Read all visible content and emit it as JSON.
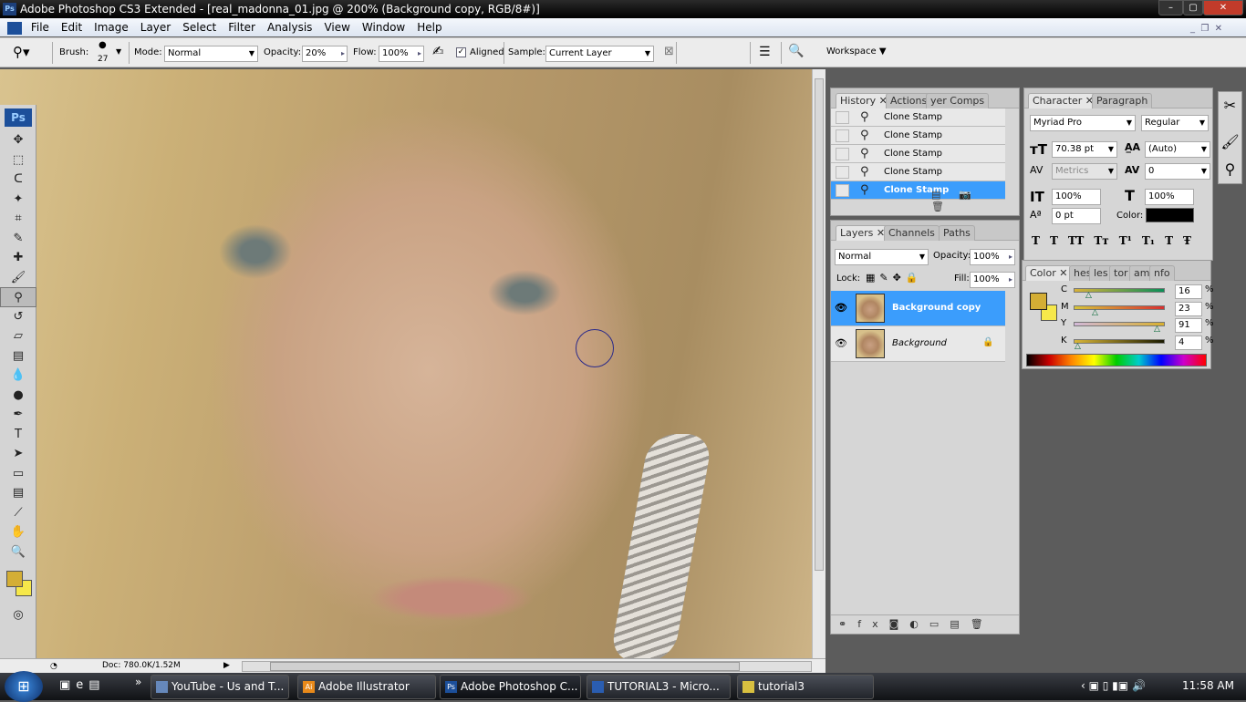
{
  "window": {
    "title": "Adobe Photoshop CS3 Extended - [real_madonna_01.jpg @ 200% (Background copy, RGB/8#)]",
    "app_icon": "Ps"
  },
  "menu": [
    "File",
    "Edit",
    "Image",
    "Layer",
    "Select",
    "Filter",
    "Analysis",
    "View",
    "Window",
    "Help"
  ],
  "options": {
    "brush_label": "Brush:",
    "brush_size": "27",
    "mode_label": "Mode:",
    "mode": "Normal",
    "opacity_label": "Opacity:",
    "opacity": "20%",
    "flow_label": "Flow:",
    "flow": "100%",
    "aligned_label": "Aligned",
    "aligned": true,
    "sample_label": "Sample:",
    "sample": "Current Layer",
    "workspace": "Workspace ▼"
  },
  "history": {
    "tabs": [
      "History",
      "Actions",
      "yer Comps"
    ],
    "items": [
      "Clone Stamp",
      "Clone Stamp",
      "Clone Stamp",
      "Clone Stamp",
      "Clone Stamp"
    ]
  },
  "layers": {
    "tabs": [
      "Layers",
      "Channels",
      "Paths"
    ],
    "blend": "Normal",
    "opacity_label": "Opacity:",
    "opacity": "100%",
    "lock_label": "Lock:",
    "fill_label": "Fill:",
    "fill": "100%",
    "items": [
      {
        "name": "Background copy",
        "selected": true
      },
      {
        "name": "Background",
        "locked": true
      }
    ]
  },
  "character": {
    "tabs": [
      "Character",
      "Paragraph"
    ],
    "font": "Myriad Pro",
    "style": "Regular",
    "size": "70.38 pt",
    "leading": "(Auto)",
    "kerning": "Metrics",
    "tracking": "0",
    "vscale": "100%",
    "hscale": "100%",
    "baseline": "0 pt",
    "color_label": "Color:",
    "text_color": "#000000",
    "style_buttons": [
      "T",
      "T",
      "TT",
      "Tт",
      "T¹",
      "T₁",
      "T",
      "Ŧ"
    ]
  },
  "color": {
    "tabs": [
      "Color",
      "hes",
      "les",
      "tor",
      "am",
      "nfo"
    ],
    "fg": "#d4ae35",
    "bg": "#f6e84a",
    "channels": [
      {
        "label": "C",
        "value": "16",
        "unit": "%"
      },
      {
        "label": "M",
        "value": "23",
        "unit": "%"
      },
      {
        "label": "Y",
        "value": "91",
        "unit": "%"
      },
      {
        "label": "K",
        "value": "4",
        "unit": "%"
      }
    ]
  },
  "status": {
    "doc": "Doc: 780.0K/1.52M"
  },
  "taskbar": {
    "items": [
      {
        "label": "YouTube - Us and T...",
        "icon": "firefox-icon"
      },
      {
        "label": "Adobe Illustrator",
        "icon": "Ai"
      },
      {
        "label": "Adobe Photoshop C...",
        "icon": "Ps"
      },
      {
        "label": "TUTORIAL3 - Micro...",
        "icon": "word-icon"
      },
      {
        "label": "tutorial3",
        "icon": "folder-icon"
      }
    ],
    "clock": "11:58 AM"
  }
}
